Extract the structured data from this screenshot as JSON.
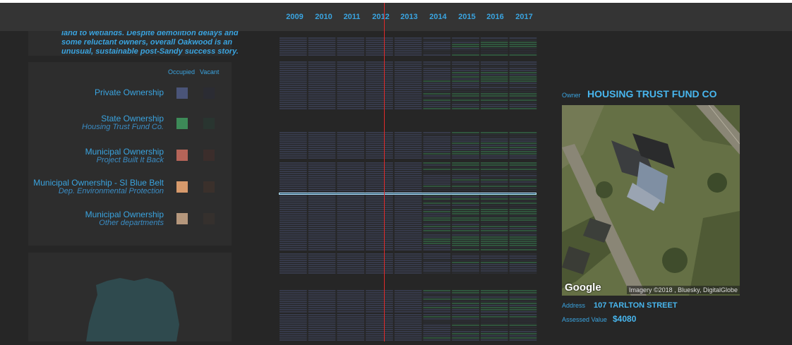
{
  "years": [
    "2009",
    "2010",
    "2011",
    "2012",
    "2013",
    "2014",
    "2015",
    "2016",
    "2017"
  ],
  "intro_lines": [
    "land to wetlands. Despite demolition delays and",
    "some reluctant owners, overall Oakwood is an",
    "unusual, sustainable post-Sandy success story."
  ],
  "legend": {
    "occupied_label": "Occupied",
    "vacant_label": "Vacant",
    "rows": [
      {
        "title": "Private Ownership",
        "subtitle": "",
        "occupied_color": "#4a5478",
        "vacant_color": "#2b2c33"
      },
      {
        "title": "State Ownership",
        "subtitle": "Housing Trust Fund Co.",
        "occupied_color": "#3d8a58",
        "vacant_color": "#293530"
      },
      {
        "title": "Municipal Ownership",
        "subtitle": "Project Built It Back",
        "occupied_color": "#b56458",
        "vacant_color": "#3b2d2b"
      },
      {
        "title": "Municipal Ownership - SI Blue Belt",
        "subtitle": "Dep. Environmental Protection",
        "occupied_color": "#d79a6c",
        "vacant_color": "#3a302b"
      },
      {
        "title": "Municipal Ownership",
        "subtitle": "Other departments",
        "occupied_color": "#b5977c",
        "vacant_color": "#35302d"
      }
    ]
  },
  "colors": {
    "accent": "#3aa4e0",
    "private": "#4a5478",
    "state": "#3d8a58",
    "highlight": "#b9e6ff",
    "cursor": "#e02a2a"
  },
  "detail": {
    "owner_label": "Owner",
    "owner_value": "HOUSING TRUST FUND CO",
    "address_label": "Address",
    "address_value": "107 TARLTON STREET",
    "assessed_label": "Assessed Value",
    "assessed_value": "$4080",
    "map_logo": "Google",
    "map_attribution": "Imagery ©2018 , Bluesky, DigitalGlobe"
  }
}
